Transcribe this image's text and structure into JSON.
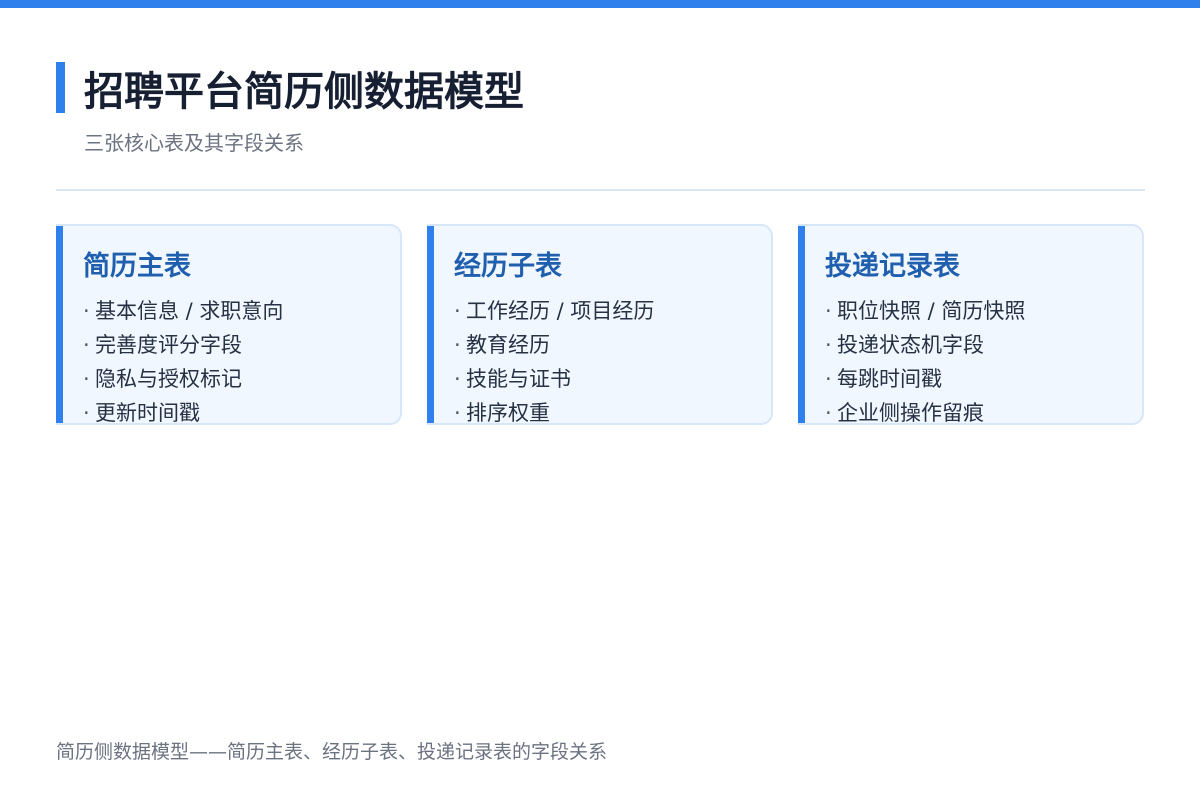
{
  "colors": {
    "accent": "#2f80ed",
    "card_background": "#f1f7ff",
    "card_border": "#d7e6f8",
    "card_title": "#1f5fae"
  },
  "header": {
    "title": "招聘平台简历侧数据模型",
    "subtitle": "三张核心表及其字段关系"
  },
  "cards": [
    {
      "title": "简历主表",
      "items": [
        "基本信息 / 求职意向",
        "完善度评分字段",
        "隐私与授权标记",
        "更新时间戳"
      ]
    },
    {
      "title": "经历子表",
      "items": [
        "工作经历 / 项目经历",
        "教育经历",
        "技能与证书",
        "排序权重"
      ]
    },
    {
      "title": "投递记录表",
      "items": [
        "职位快照 / 简历快照",
        "投递状态机字段",
        "每跳时间戳",
        "企业侧操作留痕"
      ]
    }
  ],
  "bullet_symbol": "·",
  "caption": "简历侧数据模型——简历主表、经历子表、投递记录表的字段关系"
}
